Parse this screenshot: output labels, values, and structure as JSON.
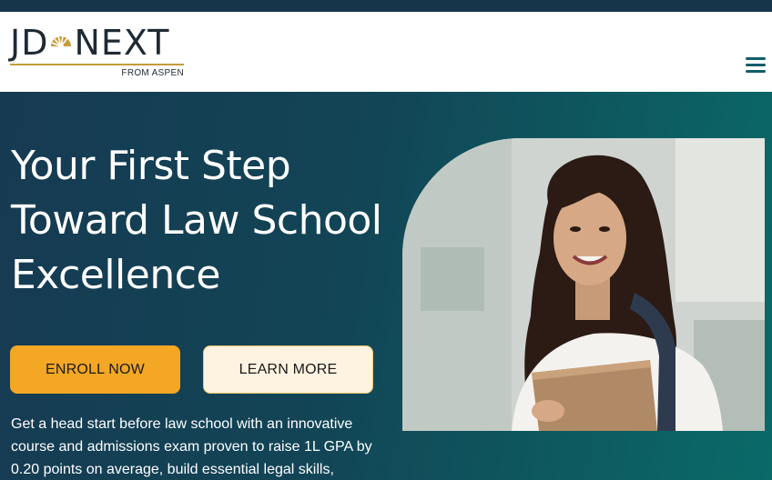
{
  "header": {
    "logo_left": "JD",
    "logo_right": "NEXT",
    "logo_sub": "FROM ASPEN",
    "menu_icon": "hamburger-menu-icon"
  },
  "hero": {
    "headline": [
      "Your First Step",
      "Toward Law School",
      "Excellence"
    ],
    "enroll_label": "ENROLL NOW",
    "learn_label": "LEARN MORE",
    "description": "Get a head start before law school with an innovative course and admissions exam proven to raise 1L GPA by 0.20 points on average, build essential legal skills,",
    "photo_icon": "student-photo"
  },
  "colors": {
    "top_strip": "#16354a",
    "hero_start": "#163a52",
    "hero_end": "#0a6a68",
    "enroll_bg": "#f3a724",
    "learn_bg": "#fdf3e0",
    "logo_gold": "#c69c3a",
    "menu_teal": "#135d6a"
  }
}
